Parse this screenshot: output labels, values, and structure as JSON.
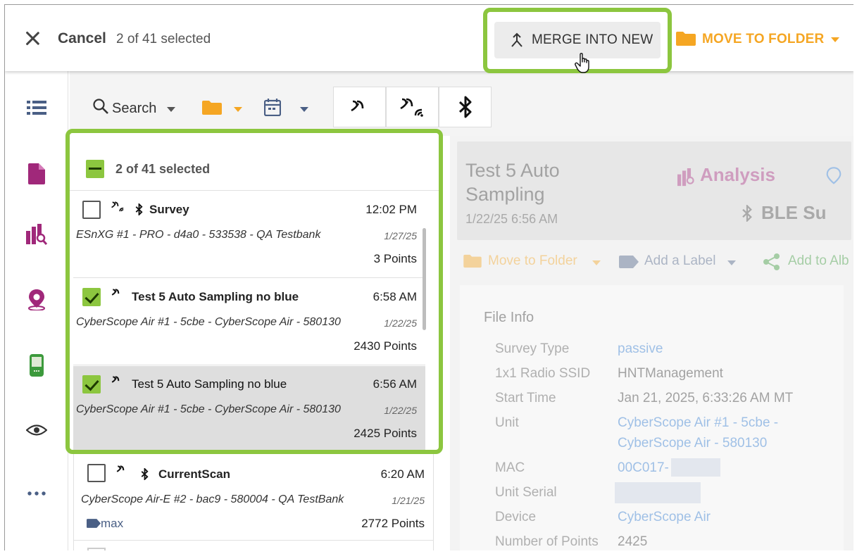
{
  "topbar": {
    "cancel_label": "Cancel",
    "selected_text": "2 of 41 selected",
    "merge_label": "MERGE INTO NEW",
    "move_label": "MOVE TO FOLDER"
  },
  "filter": {
    "search_label": "Search"
  },
  "list": {
    "header": "2 of 41 selected",
    "rows": [
      {
        "title": "Survey",
        "time": "12:02 PM",
        "desc": "ESnXG #1 - PRO - d4a0 - 533538 - QA Testbank",
        "date": "1/27/25",
        "points": "3 Points",
        "checked": false,
        "selected": false
      },
      {
        "title": "Test 5 Auto Sampling no blue",
        "time": "6:58 AM",
        "desc": "CyberScope Air #1 - 5cbe - CyberScope Air - 580130",
        "date": "1/22/25",
        "points": "2430 Points",
        "checked": true,
        "selected": false
      },
      {
        "title": "Test 5 Auto Sampling no blue",
        "time": "6:56 AM",
        "desc": "CyberScope Air #1 - 5cbe - CyberScope Air - 580130",
        "date": "1/22/25",
        "points": "2425 Points",
        "checked": true,
        "selected": true
      },
      {
        "title": "CurrentScan",
        "time": "6:20 AM",
        "desc": "CyberScope Air-E #2 - bac9 - 580004 - QA TestBank",
        "date": "1/21/25",
        "points": "2772 Points",
        "label": "max",
        "checked": false,
        "selected": false
      }
    ]
  },
  "detail": {
    "title": "Test 5 Auto Sampling",
    "date": "1/22/25 6:56 AM",
    "analysis_tab": "Analysis",
    "ble_tab": "BLE Su",
    "move_label": "Move to Folder",
    "add_label": "Add a Label",
    "add_album": "Add to Alb",
    "file_info_title": "File Info",
    "fields": [
      {
        "key": "Survey Type",
        "value": "passive"
      },
      {
        "key": "1x1 Radio SSID",
        "value": "HNTManagement"
      },
      {
        "key": "Start Time",
        "value": "Jan 21, 2025, 6:33:26 AM MT"
      },
      {
        "key": "Unit",
        "value": "CyberScope Air #1 - 5cbe -",
        "value2": "CyberScope Air - 580130"
      },
      {
        "key": "MAC",
        "value": "00C017-"
      },
      {
        "key": "Unit Serial",
        "value": ""
      },
      {
        "key": "Device",
        "value": "CyberScope Air"
      },
      {
        "key": "Number of Points",
        "value": "2425"
      }
    ]
  },
  "colors": {
    "accent_green": "#8cc63f",
    "folder_orange": "#f5a623",
    "rail_purple": "#a0287a",
    "link_blue": "#2e7bd6"
  }
}
